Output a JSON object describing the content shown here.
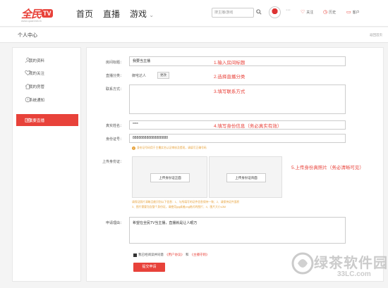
{
  "header": {
    "logo_text": "全民",
    "logo_badge": "TV",
    "logo_url": "www.quanmin.tv",
    "nav": [
      "首页",
      "直播",
      "游戏"
    ],
    "search_placeholder": "搜主播/游戏",
    "more": "···",
    "top_links": [
      "关注",
      "历史",
      "客户"
    ]
  },
  "breadcrumb": {
    "title": "个人中心",
    "back": "返回首页"
  },
  "sidebar": {
    "items": [
      {
        "label": "我的资料",
        "icon": "user-icon",
        "active": false
      },
      {
        "label": "我的关注",
        "icon": "heart-icon",
        "active": false
      },
      {
        "label": "我的房管",
        "icon": "home-icon",
        "active": false
      },
      {
        "label": "系统通知",
        "icon": "notice-icon",
        "active": false
      },
      {
        "label": "我要直播",
        "icon": "camera-icon",
        "active": true
      }
    ]
  },
  "form": {
    "room_title_label": "房间标题：",
    "room_title_value": "我要当主播",
    "room_title_hint": "1.输入房间标题",
    "category_label": "直播分类：",
    "category_value": "御宅达人",
    "category_button": "更改",
    "category_hint": "2.选择直播分类",
    "contact_label": "联系方式：",
    "contact_hint": "3.填写联系方式",
    "realname_label": "真实姓名：",
    "realname_value": "****",
    "realname_hint": "4.填写身份信息（务必真实有效）",
    "idnum_label": "身份证号：",
    "idnum_value": "888888888888888888",
    "id_warning": "身份证号码用于主播实名认证审核及提现，请填写正确号码",
    "upload_label": "上传身份证：",
    "upload_front": "上传身份证正面",
    "upload_back": "上传身份证背面",
    "upload_hint": "5.上传身份真照片（务必清晰可见）",
    "upload_notes": [
      "请保证照片清晰且能识别以下信息：1、与所填写的证件信息保持一致；2、请保持证件面积",
      "3、图片需要包含整个身份证，请使用jpg或者png格式的图片；4、图片大小≤3M"
    ],
    "reason_label": "申请理由：",
    "reason_value": "希望在全民TV当主播，直播就是让人眼万",
    "agree_text": "我已经阅读并同意",
    "agree_link1": "《用户协议》",
    "agree_and": "和",
    "agree_link2": "《主播守则》",
    "submit": "提交申请"
  },
  "watermark": {
    "text": "绿茶软件园",
    "url": "33LC.com"
  },
  "colors": {
    "accent": "#e8423a",
    "warning": "#e6a23c"
  }
}
